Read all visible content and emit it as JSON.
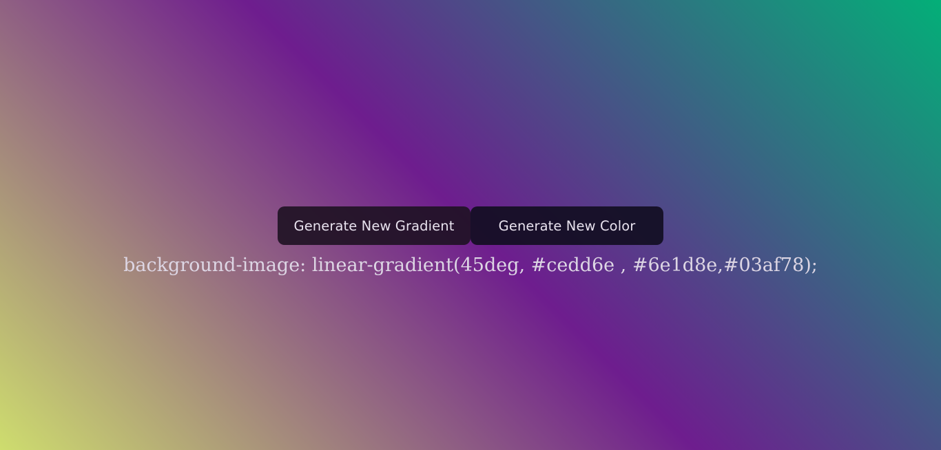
{
  "buttons": {
    "generate_gradient_label": "Generate New Gradient",
    "generate_color_label": "Generate New Color"
  },
  "output": {
    "css_text": "background-image: linear-gradient(45deg, #cedd6e , #6e1d8e,#03af78);"
  },
  "gradient": {
    "angle": "45deg",
    "colors": [
      "#cedd6e",
      "#6e1d8e",
      "#03af78"
    ]
  },
  "colors": {
    "button_background": "#1a1322",
    "button_text": "#e8e2ee",
    "output_text": "#ddd6e4"
  }
}
